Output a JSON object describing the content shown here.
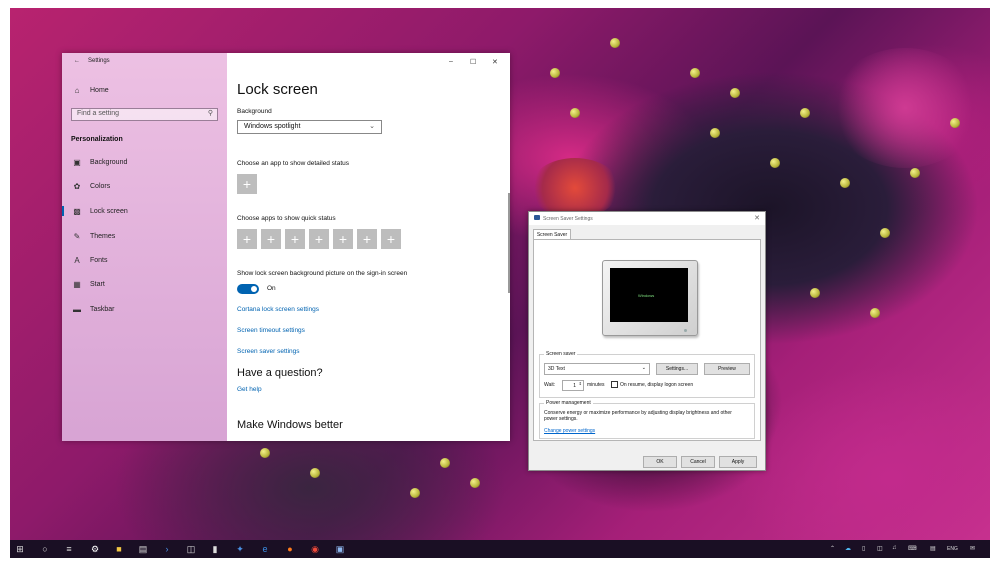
{
  "settings": {
    "title": "Settings",
    "home": "Home",
    "search_placeholder": "Find a setting",
    "section": "Personalization",
    "nav": [
      {
        "label": "Background",
        "icon": "image-icon"
      },
      {
        "label": "Colors",
        "icon": "palette-icon"
      },
      {
        "label": "Lock screen",
        "icon": "lock-screen-icon"
      },
      {
        "label": "Themes",
        "icon": "brush-icon"
      },
      {
        "label": "Fonts",
        "icon": "font-icon"
      },
      {
        "label": "Start",
        "icon": "start-icon"
      },
      {
        "label": "Taskbar",
        "icon": "taskbar-icon"
      }
    ],
    "page_title": "Lock screen",
    "background_label": "Background",
    "background_value": "Windows spotlight",
    "detailed_status_label": "Choose an app to show detailed status",
    "quick_status_label": "Choose apps to show quick status",
    "signin_label": "Show lock screen background picture on the sign-in screen",
    "toggle_state": "On",
    "links": [
      "Cortana lock screen settings",
      "Screen timeout settings",
      "Screen saver settings"
    ],
    "question_heading": "Have a question?",
    "get_help": "Get help",
    "better_heading": "Make Windows better"
  },
  "screensaver": {
    "title": "Screen Saver Settings",
    "tab": "Screen Saver",
    "preview_text": "Windows",
    "group_label": "Screen saver",
    "selected": "3D Text",
    "settings_button": "Settings...",
    "preview_button": "Preview",
    "wait_label": "Wait:",
    "wait_value": "1",
    "minutes_label": "minutes",
    "resume_label": "On resume, display logon screen",
    "power_label": "Power management",
    "power_text": "Conserve energy or maximize performance by adjusting display brightness and other power settings.",
    "power_link": "Change power settings",
    "ok": "OK",
    "cancel": "Cancel",
    "apply": "Apply"
  },
  "taskbar": {
    "lang": "ENG"
  },
  "colors": {
    "accent": "#0063b1",
    "sidebar": "#e2b4dc",
    "taskbar": "#1a0f24"
  }
}
